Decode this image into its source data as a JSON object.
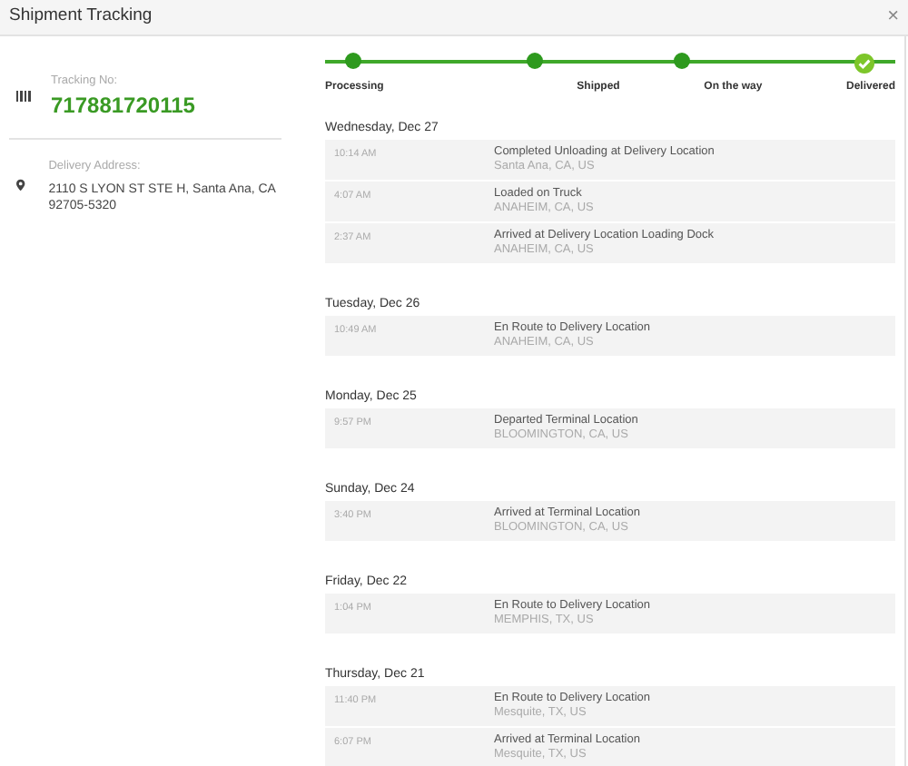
{
  "window": {
    "title": "Shipment Tracking",
    "close": "×"
  },
  "tracking": {
    "label": "Tracking No:",
    "number": "717881720115"
  },
  "address": {
    "label": "Delivery Address:",
    "text": "2110 S LYON ST STE H, Santa Ana, CA 92705-5320"
  },
  "steps": [
    {
      "label": "Processing",
      "completed": true,
      "current": false
    },
    {
      "label": "Shipped",
      "completed": true,
      "current": false
    },
    {
      "label": "On the way",
      "completed": true,
      "current": false
    },
    {
      "label": "Delivered",
      "completed": true,
      "current": true
    }
  ],
  "days": [
    {
      "date": "Wednesday, Dec 27",
      "events": [
        {
          "time": "10:14 AM",
          "status": "Completed Unloading at Delivery Location",
          "location": "Santa Ana, CA, US"
        },
        {
          "time": "4:07 AM",
          "status": "Loaded on Truck",
          "location": "ANAHEIM, CA, US"
        },
        {
          "time": "2:37 AM",
          "status": "Arrived at Delivery Location Loading Dock",
          "location": "ANAHEIM, CA, US"
        }
      ]
    },
    {
      "date": "Tuesday, Dec 26",
      "events": [
        {
          "time": "10:49 AM",
          "status": "En Route to Delivery Location",
          "location": "ANAHEIM, CA, US"
        }
      ]
    },
    {
      "date": "Monday, Dec 25",
      "events": [
        {
          "time": "9:57 PM",
          "status": "Departed Terminal Location",
          "location": "BLOOMINGTON, CA, US"
        }
      ]
    },
    {
      "date": "Sunday, Dec 24",
      "events": [
        {
          "time": "3:40 PM",
          "status": "Arrived at Terminal Location",
          "location": "BLOOMINGTON, CA, US"
        }
      ]
    },
    {
      "date": "Friday, Dec 22",
      "events": [
        {
          "time": "1:04 PM",
          "status": "En Route to Delivery Location",
          "location": "MEMPHIS, TX, US"
        }
      ]
    },
    {
      "date": "Thursday, Dec 21",
      "events": [
        {
          "time": "11:40 PM",
          "status": "En Route to Delivery Location",
          "location": "Mesquite, TX, US"
        },
        {
          "time": "6:07 PM",
          "status": "Arrived at Terminal Location",
          "location": "Mesquite, TX, US"
        }
      ]
    }
  ]
}
